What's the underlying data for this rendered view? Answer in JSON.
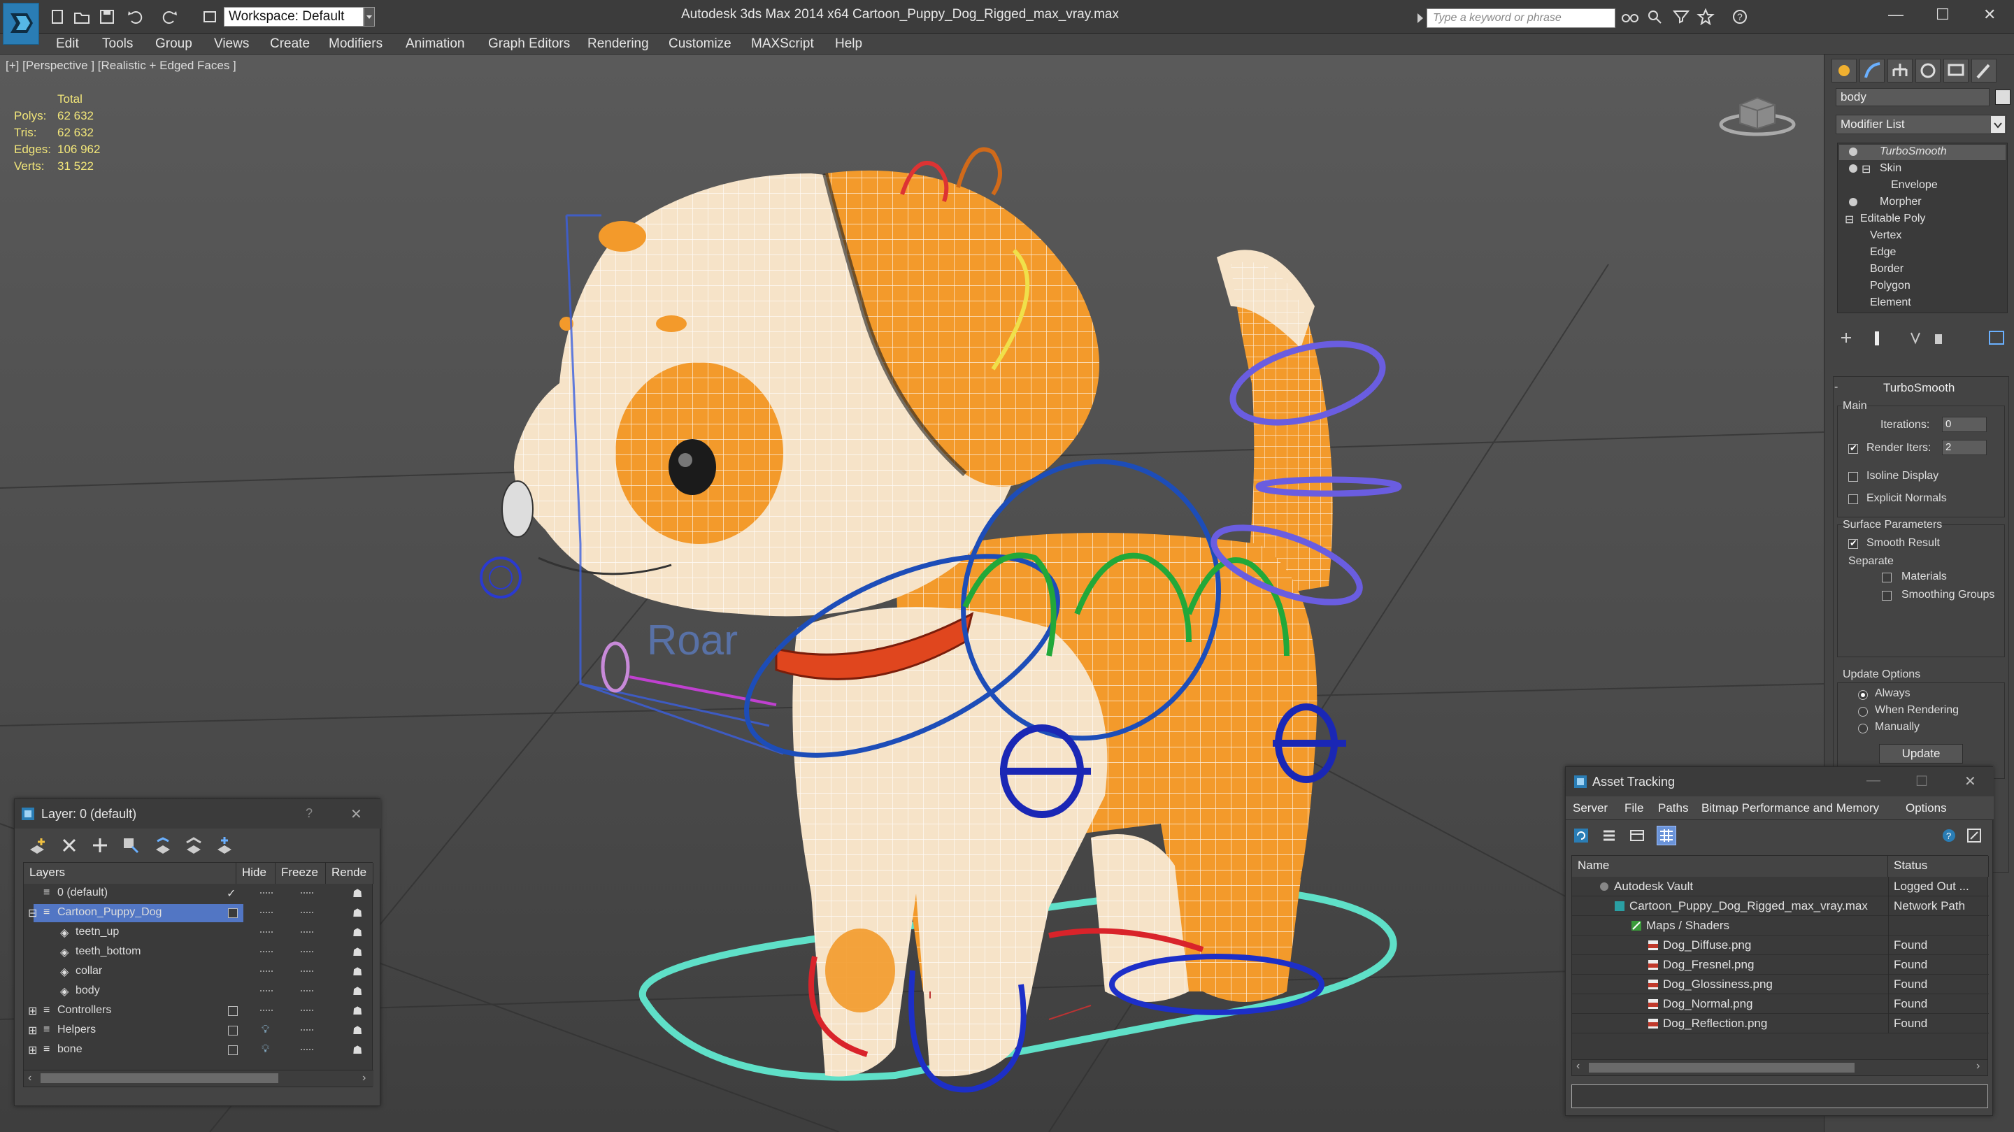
{
  "window": {
    "title": "Autodesk 3ds Max  2014 x64     Cartoon_Puppy_Dog_Rigged_max_vray.max",
    "workspace": "Workspace: Default",
    "search_placeholder": "Type a keyword or phrase",
    "minimize": "—",
    "maximize": "☐",
    "close": "✕"
  },
  "menu": [
    "Edit",
    "Tools",
    "Group",
    "Views",
    "Create",
    "Modifiers",
    "Animation",
    "Graph Editors",
    "Rendering",
    "Customize",
    "MAXScript",
    "Help"
  ],
  "viewport": {
    "label": "[+] [Perspective ] [Realistic + Edged Faces ]",
    "stats_header": "Total",
    "stats": [
      {
        "label": "Polys:",
        "value": "62 632"
      },
      {
        "label": "Tris:",
        "value": "62 632"
      },
      {
        "label": "Edges:",
        "value": "106 962"
      },
      {
        "label": "Verts:",
        "value": "31 522"
      }
    ],
    "roar_text": "Roar",
    "colors": {
      "orange": "#f39a2b",
      "cream": "#f6e3c8",
      "collar": "#e0461e",
      "blue": "#1f2fb8",
      "green": "#22a839",
      "teal": "#5fe0c8",
      "purple": "#6a5de0"
    }
  },
  "command_panel": {
    "object_name": "body",
    "modifier_list": "Modifier List",
    "stack": [
      {
        "label": "TurboSmooth",
        "italic": true
      },
      {
        "label": "Skin"
      },
      {
        "label": "Envelope"
      },
      {
        "label": "Morpher"
      },
      {
        "label": "Editable Poly"
      },
      {
        "label": "Vertex"
      },
      {
        "label": "Edge"
      },
      {
        "label": "Border"
      },
      {
        "label": "Polygon"
      },
      {
        "label": "Element"
      }
    ],
    "turbosmooth": {
      "title": "TurboSmooth",
      "main": "Main",
      "iterations_label": "Iterations:",
      "iterations_value": "0",
      "render_iters_label": "Render Iters:",
      "render_iters_value": "2",
      "isoline": "Isoline Display",
      "explicit_normals": "Explicit Normals",
      "surface_params": "Surface Parameters",
      "smooth_result": "Smooth Result",
      "separate": "Separate",
      "materials": "Materials",
      "smoothing_groups": "Smoothing Groups",
      "update_options": "Update Options",
      "always": "Always",
      "when_rendering": "When Rendering",
      "manually": "Manually",
      "update_button": "Update"
    }
  },
  "layer_panel": {
    "title": "Layer: 0 (default)",
    "help": "?",
    "close": "✕",
    "columns": [
      "Layers",
      "Hide",
      "Freeze",
      "Rende"
    ],
    "rows": [
      "0 (default)",
      "Cartoon_Puppy_Dog",
      "teetn_up",
      "teeth_bottom",
      "collar",
      "body",
      "Controllers",
      "Helpers",
      "bone"
    ]
  },
  "asset_panel": {
    "title": "Asset Tracking",
    "menu": [
      "Server",
      "File",
      "Paths",
      "Bitmap Performance and Memory",
      "Options"
    ],
    "columns": [
      "Name",
      "Status"
    ],
    "rows": [
      {
        "name": "Autodesk Vault",
        "status": "Logged Out ..."
      },
      {
        "name": "Cartoon_Puppy_Dog_Rigged_max_vray.max",
        "status": "Network Path"
      },
      {
        "name": "Maps / Shaders",
        "status": ""
      },
      {
        "name": "Dog_Diffuse.png",
        "status": "Found"
      },
      {
        "name": "Dog_Fresnel.png",
        "status": "Found"
      },
      {
        "name": "Dog_Glossiness.png",
        "status": "Found"
      },
      {
        "name": "Dog_Normal.png",
        "status": "Found"
      },
      {
        "name": "Dog_Reflection.png",
        "status": "Found"
      }
    ]
  }
}
